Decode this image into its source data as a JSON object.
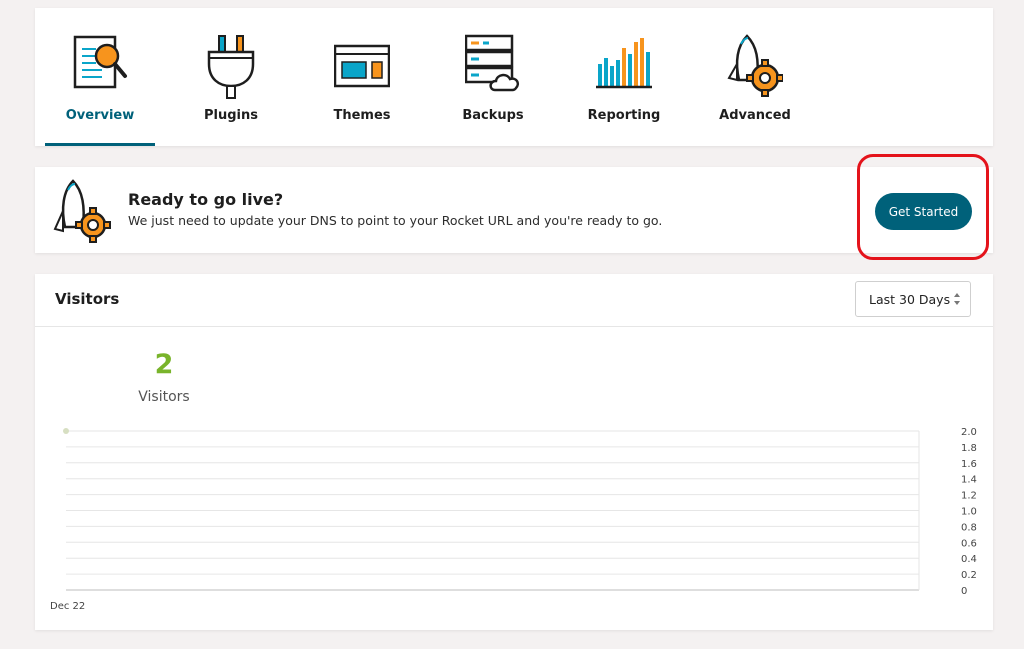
{
  "nav": {
    "tabs": [
      {
        "label": "Overview",
        "icon": "magnifier-document-icon",
        "active": true
      },
      {
        "label": "Plugins",
        "icon": "plug-icon",
        "active": false
      },
      {
        "label": "Themes",
        "icon": "browser-window-icon",
        "active": false
      },
      {
        "label": "Backups",
        "icon": "server-cloud-icon",
        "active": false
      },
      {
        "label": "Reporting",
        "icon": "bar-chart-icon",
        "active": false
      },
      {
        "label": "Advanced",
        "icon": "rocket-gear-icon",
        "active": false
      }
    ]
  },
  "golive": {
    "title": "Ready to go live?",
    "description": "We just need to update your DNS to point to your Rocket URL and you're ready to go.",
    "button_label": "Get Started",
    "icon": "rocket-gear-icon"
  },
  "visitors": {
    "title": "Visitors",
    "range_selected": "Last 30 Days",
    "count": "2",
    "count_label": "Visitors"
  },
  "colors": {
    "accent": "#00617a",
    "stat_green": "#79b42b",
    "highlight_red": "#e4131b",
    "icon_orange": "#f7941d",
    "icon_blue": "#0aa5c9"
  },
  "chart_data": {
    "type": "line",
    "x": [
      "Dec 22"
    ],
    "xlabel": "",
    "ylabel": "",
    "series": [
      {
        "values": [
          2.0
        ]
      }
    ],
    "ylim": [
      0,
      2.0
    ],
    "yticks": [
      "2.0",
      "1.8",
      "1.6",
      "1.4",
      "1.2",
      "1.0",
      "0.8",
      "0.6",
      "0.4",
      "0.2",
      "0"
    ],
    "grid": true
  }
}
